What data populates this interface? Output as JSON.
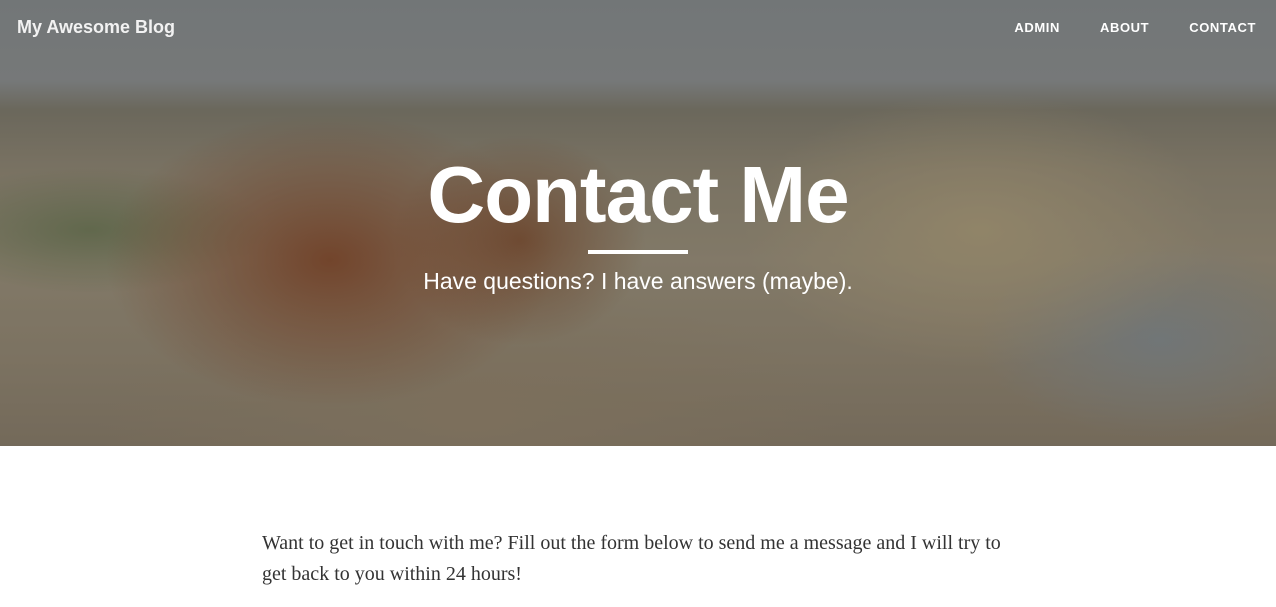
{
  "navbar": {
    "brand": "My Awesome Blog",
    "links": [
      {
        "label": "ADMIN"
      },
      {
        "label": "ABOUT"
      },
      {
        "label": "CONTACT"
      }
    ]
  },
  "hero": {
    "title": "Contact Me",
    "subtitle": "Have questions? I have answers (maybe)."
  },
  "main": {
    "intro": "Want to get in touch with me? Fill out the form below to send me a message and I will try to get back to you within 24 hours!"
  }
}
